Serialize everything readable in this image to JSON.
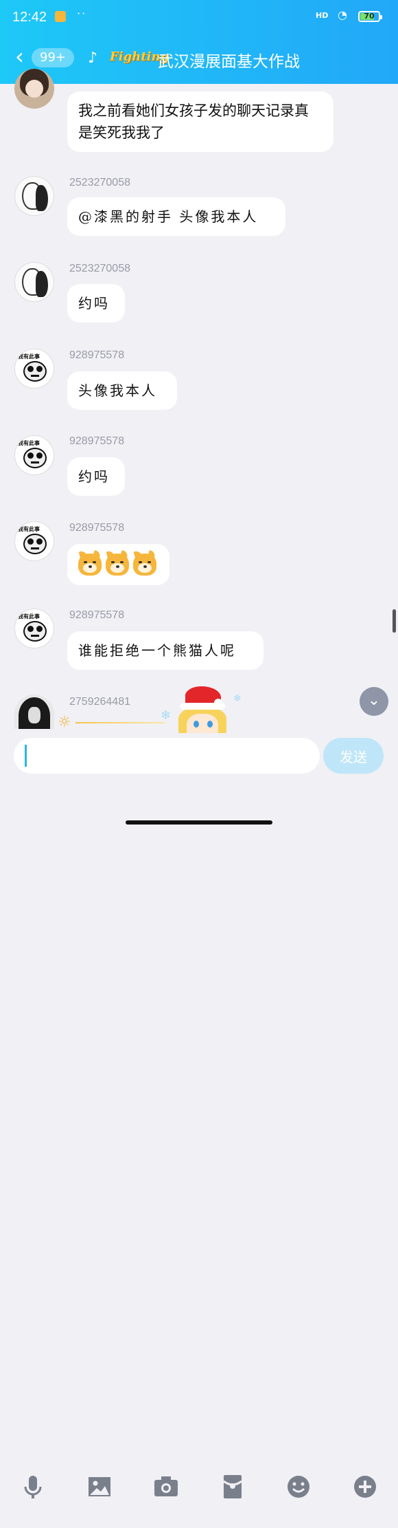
{
  "status_bar": {
    "time": "12:42",
    "network_label": "HD",
    "battery": "70"
  },
  "header": {
    "unread_count": "99+",
    "logo_text": "Fighting",
    "group_title": "武汉漫展面基大作战"
  },
  "messages": [
    {
      "sender": "",
      "text": "我之前看她们女孩子发的聊天记录真是笑死我我了",
      "avatar": "girl-avatar"
    },
    {
      "sender": "2523270058",
      "text": "@漆黑的射手 头像我本人",
      "avatar": "sketch-avatar"
    },
    {
      "sender": "2523270058",
      "text": "约吗",
      "avatar": "sketch-avatar"
    },
    {
      "sender": "928975578",
      "text": "头像我本人",
      "avatar": "panda-avatar"
    },
    {
      "sender": "928975578",
      "text": "约吗",
      "avatar": "panda-avatar"
    },
    {
      "sender": "928975578",
      "text": "",
      "avatar": "panda-avatar",
      "emoji": [
        "shiba-emoji",
        "shiba-emoji",
        "shiba-emoji"
      ]
    },
    {
      "sender": "928975578",
      "text": "谁能拒绝一个熊猫人呢",
      "avatar": "panda-avatar"
    },
    {
      "sender": "2759264481",
      "text": "",
      "avatar": "dark-hair-avatar"
    }
  ],
  "panda_avatar_caption": "我有此事",
  "composer": {
    "placeholder": "",
    "send_label": "发送"
  },
  "toolbar": [
    "microphone-icon",
    "image-icon",
    "camera-icon",
    "red-packet-icon",
    "emoji-icon",
    "plus-icon"
  ],
  "colors": {
    "header_gradient_start": "#1ec8f7",
    "header_gradient_end": "#22a8f8",
    "background": "#f0f0f5",
    "send_button": "#bfe6f8"
  }
}
